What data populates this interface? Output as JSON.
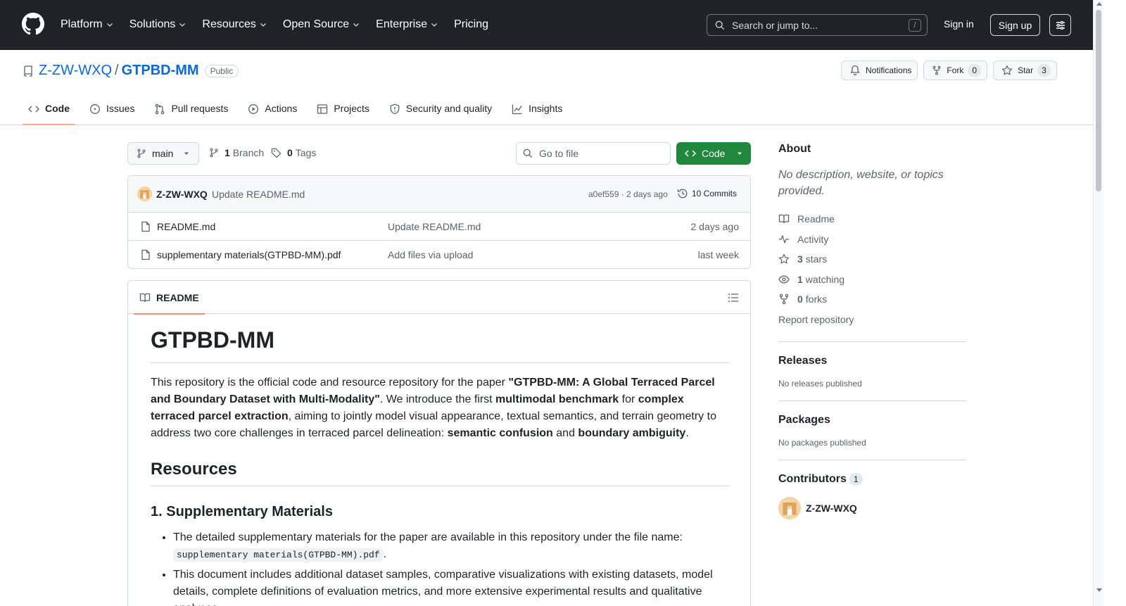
{
  "header": {
    "nav": [
      {
        "label": "Platform",
        "has_menu": true
      },
      {
        "label": "Solutions",
        "has_menu": true
      },
      {
        "label": "Resources",
        "has_menu": true
      },
      {
        "label": "Open Source",
        "has_menu": true
      },
      {
        "label": "Enterprise",
        "has_menu": true
      },
      {
        "label": "Pricing",
        "has_menu": false
      }
    ],
    "search_placeholder": "Search or jump to...",
    "search_shortcut": "/",
    "sign_in": "Sign in",
    "sign_up": "Sign up"
  },
  "repo": {
    "owner": "Z-ZW-WXQ",
    "separator": "/",
    "name": "GTPBD-MM",
    "visibility": "Public",
    "notifications_label": "Notifications",
    "fork_label": "Fork",
    "fork_count": "0",
    "star_label": "Star",
    "star_count": "3"
  },
  "tabs": [
    {
      "label": "Code",
      "icon": "code-icon",
      "active": true
    },
    {
      "label": "Issues",
      "icon": "issue-icon"
    },
    {
      "label": "Pull requests",
      "icon": "pull-request-icon"
    },
    {
      "label": "Actions",
      "icon": "play-icon"
    },
    {
      "label": "Projects",
      "icon": "table-icon"
    },
    {
      "label": "Security and quality",
      "icon": "shield-icon"
    },
    {
      "label": "Insights",
      "icon": "graph-icon"
    }
  ],
  "filenav": {
    "branch": "main",
    "branch_count": "1",
    "branch_label": "Branch",
    "tag_count": "0",
    "tag_label": "Tags",
    "go_to_file": "Go to file",
    "code_button": "Code"
  },
  "commit": {
    "author": "Z-ZW-WXQ",
    "message": "Update README.md",
    "hash_age": "a0ef559 · 2 days ago",
    "commits": "10 Commits"
  },
  "files": [
    {
      "name": "README.md",
      "message": "Update README.md",
      "date": "2 days ago"
    },
    {
      "name": "supplementary materials(GTPBD-MM).pdf",
      "message": "Add files via upload",
      "date": "last week"
    }
  ],
  "readme": {
    "tab_label": "README",
    "title": "GTPBD-MM",
    "intro_1": "This repository is the official code and resource repository for the paper ",
    "intro_paper": "\"GTPBD-MM: A Global Terraced Parcel and Boundary Dataset with Multi-Modality\"",
    "intro_2": ". We introduce the first ",
    "intro_b1": "multimodal benchmark",
    "intro_3": " for ",
    "intro_b2": "complex terraced parcel extraction",
    "intro_4": ", aiming to jointly model visual appearance, textual semantics, and terrain geometry to address two core challenges in terraced parcel delineation: ",
    "intro_b3": "semantic confusion",
    "intro_5": " and ",
    "intro_b4": "boundary ambiguity",
    "intro_6": ".",
    "h2_glyph": "",
    "h2_resources": "Resources",
    "h3_supp": "1. Supplementary Materials",
    "li1_text": "The detailed supplementary materials for the paper are available in this repository under the file name:",
    "li1_code": "supplementary materials(GTPBD-MM).pdf",
    "li1_end": ".",
    "li2_text": "This document includes additional dataset samples, comparative visualizations with existing datasets, model details, complete definitions of evaluation metrics, and more extensive experimental results and qualitative analyses."
  },
  "about": {
    "title": "About",
    "description": "No description, website, or topics provided.",
    "links": [
      {
        "icon": "book-icon",
        "count": "",
        "label": "Readme"
      },
      {
        "icon": "pulse-icon",
        "count": "",
        "label": "Activity"
      },
      {
        "icon": "star-icon",
        "count": "3",
        "label": "stars"
      },
      {
        "icon": "eye-icon",
        "count": "1",
        "label": "watching"
      },
      {
        "icon": "fork-icon",
        "count": "0",
        "label": "forks"
      }
    ],
    "report": "Report repository"
  },
  "releases": {
    "title": "Releases",
    "empty": "No releases published"
  },
  "packages": {
    "title": "Packages",
    "empty": "No packages published"
  },
  "contributors": {
    "title": "Contributors",
    "count": "1",
    "list": [
      {
        "name": "Z-ZW-WXQ"
      }
    ]
  },
  "colors": {
    "header_bg": "#1f2328",
    "link": "#0969da",
    "primary_btn": "#1f883d",
    "tab_underline": "#fd8c73"
  }
}
